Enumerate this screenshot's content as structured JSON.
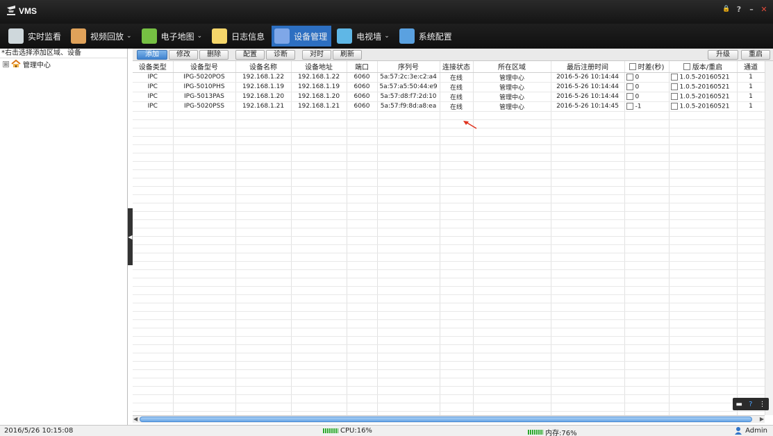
{
  "app": {
    "title": "VMS"
  },
  "window_controls": {
    "lock": "🔒",
    "help": "?",
    "minimize": "–",
    "close": "✕"
  },
  "menu": [
    {
      "label": "实时监看",
      "icon": "camera-icon",
      "color": "#cfd8dc",
      "dropdown": false
    },
    {
      "label": "视频回放",
      "icon": "clock-icon",
      "color": "#e0a25a",
      "dropdown": true
    },
    {
      "label": "电子地图",
      "icon": "map-icon",
      "color": "#76c043",
      "dropdown": true
    },
    {
      "label": "日志信息",
      "icon": "notepad-icon",
      "color": "#f5d66a",
      "dropdown": false
    },
    {
      "label": "设备管理",
      "icon": "monitor-icon",
      "color": "#7fa7e8",
      "dropdown": false,
      "active": true
    },
    {
      "label": "电视墙",
      "icon": "tv-wall-icon",
      "color": "#5fb7e6",
      "dropdown": true
    },
    {
      "label": "系统配置",
      "icon": "gear-icon",
      "color": "#5aa1e0",
      "dropdown": false
    }
  ],
  "sidebar": {
    "hint": "*右击选择添加区域、设备",
    "tree_root": "管理中心",
    "expander": "⊞"
  },
  "toolbar": {
    "buttons": [
      "添加",
      "修改",
      "删除",
      "配置",
      "诊断",
      "对时",
      "刷新"
    ],
    "right_buttons": [
      "升级",
      "重启"
    ]
  },
  "table": {
    "columns": [
      "设备类型",
      "设备型号",
      "设备名称",
      "设备地址",
      "端口",
      "序列号",
      "连接状态",
      "所在区域",
      "最后注册时间",
      "时差(秒)",
      "版本/重启",
      "通道"
    ],
    "rows": [
      [
        "IPC",
        "IPG-5020POS",
        "192.168.1.22",
        "192.168.1.22",
        "6060",
        "5a:57:2c:3e:c2:a4",
        "在线",
        "管理中心",
        "2016-5-26 10:14:44",
        "0",
        "1.0.5-20160521",
        "1"
      ],
      [
        "IPC",
        "IPG-5010PHS",
        "192.168.1.19",
        "192.168.1.19",
        "6060",
        "5a:57:a5:50:44:e9",
        "在线",
        "管理中心",
        "2016-5-26 10:14:44",
        "0",
        "1.0.5-20160521",
        "1"
      ],
      [
        "IPC",
        "IPG-5013PAS",
        "192.168.1.20",
        "192.168.1.20",
        "6060",
        "5a:57:d8:f7:2d:10",
        "在线",
        "管理中心",
        "2016-5-26 10:14:44",
        "0",
        "1.0.5-20160521",
        "1"
      ],
      [
        "IPC",
        "IPG-5020PSS",
        "192.168.1.21",
        "192.168.1.21",
        "6060",
        "5a:57:f9:8d:a8:ea",
        "在线",
        "管理中心",
        "2016-5-26 10:14:45",
        "-1",
        "1.0.5-20160521",
        "1"
      ]
    ]
  },
  "statusbar": {
    "timestamp": "2016/5/26 10:15:08",
    "cpu": "CPU:16%",
    "memory": "内存:76%",
    "user": "Admin"
  },
  "colors": {
    "accent": "#2d6fc1",
    "annotation_arrow": "#e0321e",
    "meter": "#2da62d"
  }
}
